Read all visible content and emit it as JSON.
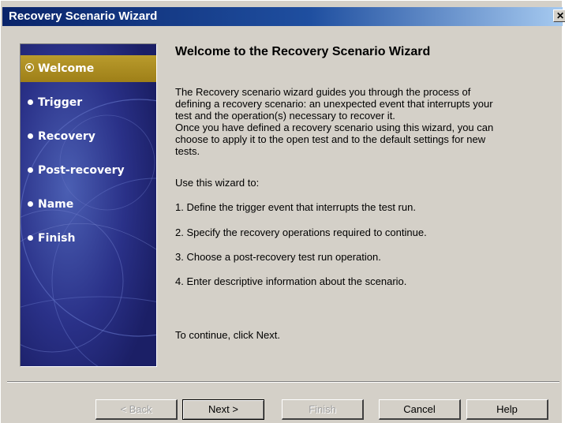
{
  "window": {
    "title": "Recovery Scenario Wizard",
    "close_glyph": "✕"
  },
  "steps": [
    {
      "label": "Welcome",
      "active": true
    },
    {
      "label": "Trigger",
      "active": false
    },
    {
      "label": "Recovery",
      "active": false
    },
    {
      "label": "Post-recovery",
      "active": false
    },
    {
      "label": "Name",
      "active": false
    },
    {
      "label": "Finish",
      "active": false
    }
  ],
  "content": {
    "heading": "Welcome to the Recovery Scenario Wizard",
    "intro_lines": [
      "The Recovery scenario wizard guides you through the process of",
      "defining a recovery scenario: an unexpected event that interrupts your",
      "test and the operation(s) necessary to recover it.",
      "Once you have defined a recovery scenario using this wizard, you can",
      "choose to apply it to the open test and to the default settings for new",
      "tests."
    ],
    "use_label": "Use this wizard to:",
    "items": [
      "1. Define the trigger event that interrupts the test run.",
      "2. Specify the recovery operations required to continue.",
      "3. Choose a post-recovery test run operation.",
      "4. Enter descriptive information about the scenario."
    ],
    "continue_text": "To continue, click Next."
  },
  "buttons": {
    "back": "< Back",
    "next": "Next >",
    "finish": "Finish",
    "cancel": "Cancel",
    "help": "Help"
  },
  "colors": {
    "panel_bg": "#23287a",
    "active_step": "#b99b2c",
    "title_bar": "#0a246a"
  }
}
